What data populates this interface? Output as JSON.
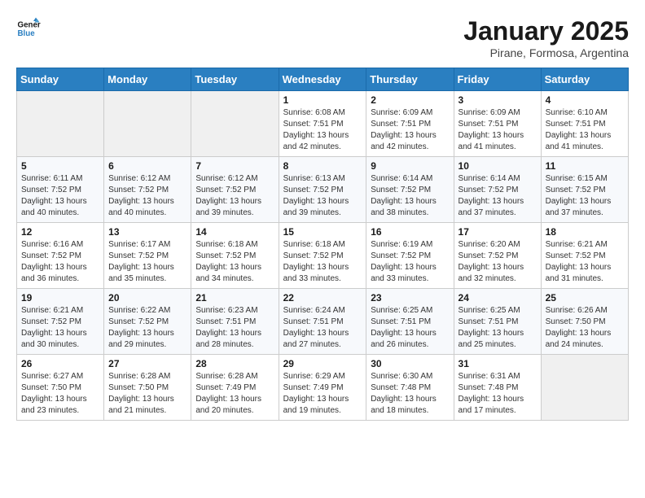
{
  "header": {
    "logo_line1": "General",
    "logo_line2": "Blue",
    "month_title": "January 2025",
    "subtitle": "Pirane, Formosa, Argentina"
  },
  "days_of_week": [
    "Sunday",
    "Monday",
    "Tuesday",
    "Wednesday",
    "Thursday",
    "Friday",
    "Saturday"
  ],
  "weeks": [
    [
      {
        "day": "",
        "info": ""
      },
      {
        "day": "",
        "info": ""
      },
      {
        "day": "",
        "info": ""
      },
      {
        "day": "1",
        "info": "Sunrise: 6:08 AM\nSunset: 7:51 PM\nDaylight: 13 hours\nand 42 minutes."
      },
      {
        "day": "2",
        "info": "Sunrise: 6:09 AM\nSunset: 7:51 PM\nDaylight: 13 hours\nand 42 minutes."
      },
      {
        "day": "3",
        "info": "Sunrise: 6:09 AM\nSunset: 7:51 PM\nDaylight: 13 hours\nand 41 minutes."
      },
      {
        "day": "4",
        "info": "Sunrise: 6:10 AM\nSunset: 7:51 PM\nDaylight: 13 hours\nand 41 minutes."
      }
    ],
    [
      {
        "day": "5",
        "info": "Sunrise: 6:11 AM\nSunset: 7:52 PM\nDaylight: 13 hours\nand 40 minutes."
      },
      {
        "day": "6",
        "info": "Sunrise: 6:12 AM\nSunset: 7:52 PM\nDaylight: 13 hours\nand 40 minutes."
      },
      {
        "day": "7",
        "info": "Sunrise: 6:12 AM\nSunset: 7:52 PM\nDaylight: 13 hours\nand 39 minutes."
      },
      {
        "day": "8",
        "info": "Sunrise: 6:13 AM\nSunset: 7:52 PM\nDaylight: 13 hours\nand 39 minutes."
      },
      {
        "day": "9",
        "info": "Sunrise: 6:14 AM\nSunset: 7:52 PM\nDaylight: 13 hours\nand 38 minutes."
      },
      {
        "day": "10",
        "info": "Sunrise: 6:14 AM\nSunset: 7:52 PM\nDaylight: 13 hours\nand 37 minutes."
      },
      {
        "day": "11",
        "info": "Sunrise: 6:15 AM\nSunset: 7:52 PM\nDaylight: 13 hours\nand 37 minutes."
      }
    ],
    [
      {
        "day": "12",
        "info": "Sunrise: 6:16 AM\nSunset: 7:52 PM\nDaylight: 13 hours\nand 36 minutes."
      },
      {
        "day": "13",
        "info": "Sunrise: 6:17 AM\nSunset: 7:52 PM\nDaylight: 13 hours\nand 35 minutes."
      },
      {
        "day": "14",
        "info": "Sunrise: 6:18 AM\nSunset: 7:52 PM\nDaylight: 13 hours\nand 34 minutes."
      },
      {
        "day": "15",
        "info": "Sunrise: 6:18 AM\nSunset: 7:52 PM\nDaylight: 13 hours\nand 33 minutes."
      },
      {
        "day": "16",
        "info": "Sunrise: 6:19 AM\nSunset: 7:52 PM\nDaylight: 13 hours\nand 33 minutes."
      },
      {
        "day": "17",
        "info": "Sunrise: 6:20 AM\nSunset: 7:52 PM\nDaylight: 13 hours\nand 32 minutes."
      },
      {
        "day": "18",
        "info": "Sunrise: 6:21 AM\nSunset: 7:52 PM\nDaylight: 13 hours\nand 31 minutes."
      }
    ],
    [
      {
        "day": "19",
        "info": "Sunrise: 6:21 AM\nSunset: 7:52 PM\nDaylight: 13 hours\nand 30 minutes."
      },
      {
        "day": "20",
        "info": "Sunrise: 6:22 AM\nSunset: 7:52 PM\nDaylight: 13 hours\nand 29 minutes."
      },
      {
        "day": "21",
        "info": "Sunrise: 6:23 AM\nSunset: 7:51 PM\nDaylight: 13 hours\nand 28 minutes."
      },
      {
        "day": "22",
        "info": "Sunrise: 6:24 AM\nSunset: 7:51 PM\nDaylight: 13 hours\nand 27 minutes."
      },
      {
        "day": "23",
        "info": "Sunrise: 6:25 AM\nSunset: 7:51 PM\nDaylight: 13 hours\nand 26 minutes."
      },
      {
        "day": "24",
        "info": "Sunrise: 6:25 AM\nSunset: 7:51 PM\nDaylight: 13 hours\nand 25 minutes."
      },
      {
        "day": "25",
        "info": "Sunrise: 6:26 AM\nSunset: 7:50 PM\nDaylight: 13 hours\nand 24 minutes."
      }
    ],
    [
      {
        "day": "26",
        "info": "Sunrise: 6:27 AM\nSunset: 7:50 PM\nDaylight: 13 hours\nand 23 minutes."
      },
      {
        "day": "27",
        "info": "Sunrise: 6:28 AM\nSunset: 7:50 PM\nDaylight: 13 hours\nand 21 minutes."
      },
      {
        "day": "28",
        "info": "Sunrise: 6:28 AM\nSunset: 7:49 PM\nDaylight: 13 hours\nand 20 minutes."
      },
      {
        "day": "29",
        "info": "Sunrise: 6:29 AM\nSunset: 7:49 PM\nDaylight: 13 hours\nand 19 minutes."
      },
      {
        "day": "30",
        "info": "Sunrise: 6:30 AM\nSunset: 7:48 PM\nDaylight: 13 hours\nand 18 minutes."
      },
      {
        "day": "31",
        "info": "Sunrise: 6:31 AM\nSunset: 7:48 PM\nDaylight: 13 hours\nand 17 minutes."
      },
      {
        "day": "",
        "info": ""
      }
    ]
  ]
}
